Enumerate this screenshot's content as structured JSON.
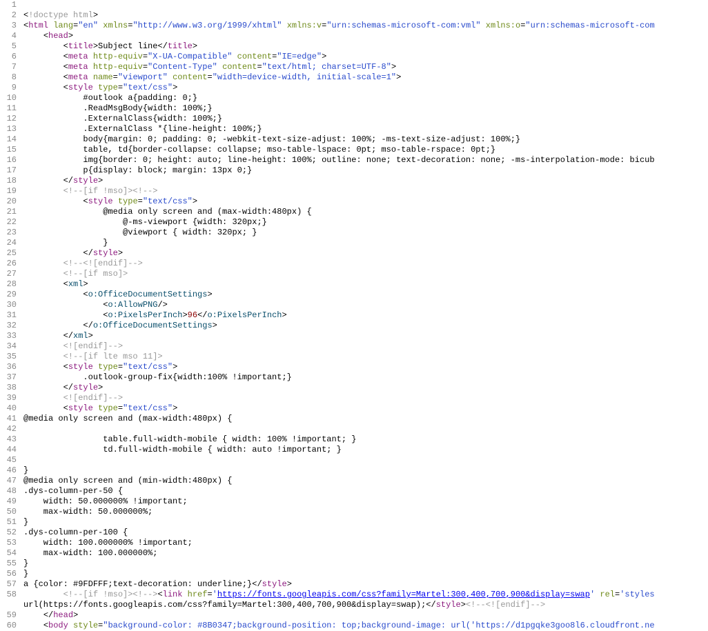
{
  "lines": [
    {
      "num": 1,
      "segs": []
    },
    {
      "num": 2,
      "segs": [
        {
          "c": "t-bracket",
          "t": "<"
        },
        {
          "c": "t-comment",
          "t": "!doctype html"
        },
        {
          "c": "t-bracket",
          "t": ">"
        }
      ]
    },
    {
      "num": 3,
      "segs": [
        {
          "c": "t-bracket",
          "t": "<"
        },
        {
          "c": "t-tag",
          "t": "html"
        },
        {
          "c": "t-text",
          "t": " "
        },
        {
          "c": "t-attr",
          "t": "lang"
        },
        {
          "c": "t-text",
          "t": "="
        },
        {
          "c": "t-val",
          "t": "\"en\""
        },
        {
          "c": "t-text",
          "t": " "
        },
        {
          "c": "t-attr",
          "t": "xmlns"
        },
        {
          "c": "t-text",
          "t": "="
        },
        {
          "c": "t-val",
          "t": "\"http://www.w3.org/1999/xhtml\""
        },
        {
          "c": "t-text",
          "t": " "
        },
        {
          "c": "t-attr",
          "t": "xmlns:v"
        },
        {
          "c": "t-text",
          "t": "="
        },
        {
          "c": "t-val",
          "t": "\"urn:schemas-microsoft-com:vml\""
        },
        {
          "c": "t-text",
          "t": " "
        },
        {
          "c": "t-attr",
          "t": "xmlns:o"
        },
        {
          "c": "t-text",
          "t": "="
        },
        {
          "c": "t-val",
          "t": "\"urn:schemas-microsoft-com"
        }
      ]
    },
    {
      "num": 4,
      "segs": [
        {
          "c": "t-text",
          "t": "    "
        },
        {
          "c": "t-bracket",
          "t": "<"
        },
        {
          "c": "t-tag",
          "t": "head"
        },
        {
          "c": "t-bracket",
          "t": ">"
        }
      ]
    },
    {
      "num": 5,
      "segs": [
        {
          "c": "t-text",
          "t": "        "
        },
        {
          "c": "t-bracket",
          "t": "<"
        },
        {
          "c": "t-tag",
          "t": "title"
        },
        {
          "c": "t-bracket",
          "t": ">"
        },
        {
          "c": "t-text",
          "t": "Subject line"
        },
        {
          "c": "t-bracket",
          "t": "</"
        },
        {
          "c": "t-tag",
          "t": "title"
        },
        {
          "c": "t-bracket",
          "t": ">"
        }
      ]
    },
    {
      "num": 6,
      "segs": [
        {
          "c": "t-text",
          "t": "        "
        },
        {
          "c": "t-bracket",
          "t": "<"
        },
        {
          "c": "t-tag",
          "t": "meta"
        },
        {
          "c": "t-text",
          "t": " "
        },
        {
          "c": "t-attr",
          "t": "http-equiv"
        },
        {
          "c": "t-text",
          "t": "="
        },
        {
          "c": "t-val",
          "t": "\"X-UA-Compatible\""
        },
        {
          "c": "t-text",
          "t": " "
        },
        {
          "c": "t-attr",
          "t": "content"
        },
        {
          "c": "t-text",
          "t": "="
        },
        {
          "c": "t-val",
          "t": "\"IE=edge\""
        },
        {
          "c": "t-bracket",
          "t": ">"
        }
      ]
    },
    {
      "num": 7,
      "segs": [
        {
          "c": "t-text",
          "t": "        "
        },
        {
          "c": "t-bracket",
          "t": "<"
        },
        {
          "c": "t-tag",
          "t": "meta"
        },
        {
          "c": "t-text",
          "t": " "
        },
        {
          "c": "t-attr",
          "t": "http-equiv"
        },
        {
          "c": "t-text",
          "t": "="
        },
        {
          "c": "t-val",
          "t": "\"Content-Type\""
        },
        {
          "c": "t-text",
          "t": " "
        },
        {
          "c": "t-attr",
          "t": "content"
        },
        {
          "c": "t-text",
          "t": "="
        },
        {
          "c": "t-val",
          "t": "\"text/html; charset=UTF-8\""
        },
        {
          "c": "t-bracket",
          "t": ">"
        }
      ]
    },
    {
      "num": 8,
      "segs": [
        {
          "c": "t-text",
          "t": "        "
        },
        {
          "c": "t-bracket",
          "t": "<"
        },
        {
          "c": "t-tag",
          "t": "meta"
        },
        {
          "c": "t-text",
          "t": " "
        },
        {
          "c": "t-attr",
          "t": "name"
        },
        {
          "c": "t-text",
          "t": "="
        },
        {
          "c": "t-val",
          "t": "\"viewport\""
        },
        {
          "c": "t-text",
          "t": " "
        },
        {
          "c": "t-attr",
          "t": "content"
        },
        {
          "c": "t-text",
          "t": "="
        },
        {
          "c": "t-val",
          "t": "\"width=device-width, initial-scale=1\""
        },
        {
          "c": "t-bracket",
          "t": ">"
        }
      ]
    },
    {
      "num": 9,
      "segs": [
        {
          "c": "t-text",
          "t": "        "
        },
        {
          "c": "t-bracket",
          "t": "<"
        },
        {
          "c": "t-tag",
          "t": "style"
        },
        {
          "c": "t-text",
          "t": " "
        },
        {
          "c": "t-attr",
          "t": "type"
        },
        {
          "c": "t-text",
          "t": "="
        },
        {
          "c": "t-val",
          "t": "\"text/css\""
        },
        {
          "c": "t-bracket",
          "t": ">"
        }
      ]
    },
    {
      "num": 10,
      "segs": [
        {
          "c": "t-text",
          "t": "            #outlook a{padding: 0;}"
        }
      ]
    },
    {
      "num": 11,
      "segs": [
        {
          "c": "t-text",
          "t": "            .ReadMsgBody{width: 100%;}"
        }
      ]
    },
    {
      "num": 12,
      "segs": [
        {
          "c": "t-text",
          "t": "            .ExternalClass{width: 100%;}"
        }
      ]
    },
    {
      "num": 13,
      "segs": [
        {
          "c": "t-text",
          "t": "            .ExternalClass *{line-height: 100%;}"
        }
      ]
    },
    {
      "num": 14,
      "segs": [
        {
          "c": "t-text",
          "t": "            body{margin: 0; padding: 0; -webkit-text-size-adjust: 100%; -ms-text-size-adjust: 100%;}"
        }
      ]
    },
    {
      "num": 15,
      "segs": [
        {
          "c": "t-text",
          "t": "            table, td{border-collapse: collapse; mso-table-lspace: 0pt; mso-table-rspace: 0pt;}"
        }
      ]
    },
    {
      "num": 16,
      "segs": [
        {
          "c": "t-text",
          "t": "            img{border: 0; height: auto; line-height: 100%; outline: none; text-decoration: none; -ms-interpolation-mode: bicub"
        }
      ]
    },
    {
      "num": 17,
      "segs": [
        {
          "c": "t-text",
          "t": "            p{display: block; margin: 13px 0;}"
        }
      ]
    },
    {
      "num": 18,
      "segs": [
        {
          "c": "t-text",
          "t": "        "
        },
        {
          "c": "t-bracket",
          "t": "</"
        },
        {
          "c": "t-tag",
          "t": "style"
        },
        {
          "c": "t-bracket",
          "t": ">"
        }
      ]
    },
    {
      "num": 19,
      "segs": [
        {
          "c": "t-text",
          "t": "        "
        },
        {
          "c": "t-comment",
          "t": "<!--[if !mso]><!-->"
        }
      ]
    },
    {
      "num": 20,
      "segs": [
        {
          "c": "t-text",
          "t": "            "
        },
        {
          "c": "t-bracket",
          "t": "<"
        },
        {
          "c": "t-tag",
          "t": "style"
        },
        {
          "c": "t-text",
          "t": " "
        },
        {
          "c": "t-attr",
          "t": "type"
        },
        {
          "c": "t-text",
          "t": "="
        },
        {
          "c": "t-val",
          "t": "\"text/css\""
        },
        {
          "c": "t-bracket",
          "t": ">"
        }
      ]
    },
    {
      "num": 21,
      "segs": [
        {
          "c": "t-text",
          "t": "                @media only screen and (max-width:480px) {"
        }
      ]
    },
    {
      "num": 22,
      "segs": [
        {
          "c": "t-text",
          "t": "                    @-ms-viewport {width: 320px;}"
        }
      ]
    },
    {
      "num": 23,
      "segs": [
        {
          "c": "t-text",
          "t": "                    @viewport { width: 320px; }"
        }
      ]
    },
    {
      "num": 24,
      "segs": [
        {
          "c": "t-text",
          "t": "                }"
        }
      ]
    },
    {
      "num": 25,
      "segs": [
        {
          "c": "t-text",
          "t": "            "
        },
        {
          "c": "t-bracket",
          "t": "</"
        },
        {
          "c": "t-tag",
          "t": "style"
        },
        {
          "c": "t-bracket",
          "t": ">"
        }
      ]
    },
    {
      "num": 26,
      "segs": [
        {
          "c": "t-text",
          "t": "        "
        },
        {
          "c": "t-comment",
          "t": "<!--<![endif]-->"
        }
      ]
    },
    {
      "num": 27,
      "segs": [
        {
          "c": "t-text",
          "t": "        "
        },
        {
          "c": "t-comment",
          "t": "<!--[if mso]>"
        }
      ]
    },
    {
      "num": 28,
      "segs": [
        {
          "c": "t-text",
          "t": "        "
        },
        {
          "c": "t-bracket",
          "t": "<"
        },
        {
          "c": "t-tag-alt",
          "t": "xml"
        },
        {
          "c": "t-bracket",
          "t": ">"
        }
      ]
    },
    {
      "num": 29,
      "segs": [
        {
          "c": "t-text",
          "t": "            "
        },
        {
          "c": "t-bracket",
          "t": "<"
        },
        {
          "c": "t-tag-alt",
          "t": "o:OfficeDocumentSettings"
        },
        {
          "c": "t-bracket",
          "t": ">"
        }
      ]
    },
    {
      "num": 30,
      "segs": [
        {
          "c": "t-text",
          "t": "                "
        },
        {
          "c": "t-bracket",
          "t": "<"
        },
        {
          "c": "t-tag-alt",
          "t": "o:AllowPNG"
        },
        {
          "c": "t-bracket",
          "t": "/>"
        }
      ]
    },
    {
      "num": 31,
      "segs": [
        {
          "c": "t-text",
          "t": "                "
        },
        {
          "c": "t-bracket",
          "t": "<"
        },
        {
          "c": "t-tag-alt",
          "t": "o:PixelsPerInch"
        },
        {
          "c": "t-bracket",
          "t": ">"
        },
        {
          "c": "t-num",
          "t": "96"
        },
        {
          "c": "t-bracket",
          "t": "</"
        },
        {
          "c": "t-tag-alt",
          "t": "o:PixelsPerInch"
        },
        {
          "c": "t-bracket",
          "t": ">"
        }
      ]
    },
    {
      "num": 32,
      "segs": [
        {
          "c": "t-text",
          "t": "            "
        },
        {
          "c": "t-bracket",
          "t": "</"
        },
        {
          "c": "t-tag-alt",
          "t": "o:OfficeDocumentSettings"
        },
        {
          "c": "t-bracket",
          "t": ">"
        }
      ]
    },
    {
      "num": 33,
      "segs": [
        {
          "c": "t-text",
          "t": "        "
        },
        {
          "c": "t-bracket",
          "t": "</"
        },
        {
          "c": "t-tag-alt",
          "t": "xml"
        },
        {
          "c": "t-bracket",
          "t": ">"
        }
      ]
    },
    {
      "num": 34,
      "segs": [
        {
          "c": "t-text",
          "t": "        "
        },
        {
          "c": "t-comment",
          "t": "<![endif]-->"
        }
      ]
    },
    {
      "num": 35,
      "segs": [
        {
          "c": "t-text",
          "t": "        "
        },
        {
          "c": "t-comment",
          "t": "<!--[if lte mso 11]>"
        }
      ]
    },
    {
      "num": 36,
      "segs": [
        {
          "c": "t-text",
          "t": "        "
        },
        {
          "c": "t-bracket",
          "t": "<"
        },
        {
          "c": "t-tag",
          "t": "style"
        },
        {
          "c": "t-text",
          "t": " "
        },
        {
          "c": "t-attr",
          "t": "type"
        },
        {
          "c": "t-text",
          "t": "="
        },
        {
          "c": "t-val",
          "t": "\"text/css\""
        },
        {
          "c": "t-bracket",
          "t": ">"
        }
      ]
    },
    {
      "num": 37,
      "segs": [
        {
          "c": "t-text",
          "t": "            .outlook-group-fix{width:100% !important;}"
        }
      ]
    },
    {
      "num": 38,
      "segs": [
        {
          "c": "t-text",
          "t": "        "
        },
        {
          "c": "t-bracket",
          "t": "</"
        },
        {
          "c": "t-tag",
          "t": "style"
        },
        {
          "c": "t-bracket",
          "t": ">"
        }
      ]
    },
    {
      "num": 39,
      "segs": [
        {
          "c": "t-text",
          "t": "        "
        },
        {
          "c": "t-comment",
          "t": "<![endif]-->"
        }
      ]
    },
    {
      "num": 40,
      "segs": [
        {
          "c": "t-text",
          "t": "        "
        },
        {
          "c": "t-bracket",
          "t": "<"
        },
        {
          "c": "t-tag",
          "t": "style"
        },
        {
          "c": "t-text",
          "t": " "
        },
        {
          "c": "t-attr",
          "t": "type"
        },
        {
          "c": "t-text",
          "t": "="
        },
        {
          "c": "t-val",
          "t": "\"text/css\""
        },
        {
          "c": "t-bracket",
          "t": ">"
        }
      ]
    },
    {
      "num": 41,
      "segs": [
        {
          "c": "t-text",
          "t": "@media only screen and (max-width:480px) {"
        }
      ]
    },
    {
      "num": 42,
      "segs": [
        {
          "c": "t-text",
          "t": ""
        }
      ]
    },
    {
      "num": 43,
      "segs": [
        {
          "c": "t-text",
          "t": "                table.full-width-mobile { width: 100% !important; }"
        }
      ]
    },
    {
      "num": 44,
      "segs": [
        {
          "c": "t-text",
          "t": "                td.full-width-mobile { width: auto !important; }"
        }
      ]
    },
    {
      "num": 45,
      "segs": [
        {
          "c": "t-text",
          "t": ""
        }
      ]
    },
    {
      "num": 46,
      "segs": [
        {
          "c": "t-text",
          "t": "}"
        }
      ]
    },
    {
      "num": 47,
      "segs": [
        {
          "c": "t-text",
          "t": "@media only screen and (min-width:480px) {"
        }
      ]
    },
    {
      "num": 48,
      "segs": [
        {
          "c": "t-text",
          "t": ".dys-column-per-50 {"
        }
      ]
    },
    {
      "num": 49,
      "segs": [
        {
          "c": "t-text",
          "t": "    width: 50.000000% !important;"
        }
      ]
    },
    {
      "num": 50,
      "segs": [
        {
          "c": "t-text",
          "t": "    max-width: 50.000000%;"
        }
      ]
    },
    {
      "num": 51,
      "segs": [
        {
          "c": "t-text",
          "t": "}"
        }
      ]
    },
    {
      "num": 52,
      "segs": [
        {
          "c": "t-text",
          "t": ".dys-column-per-100 {"
        }
      ]
    },
    {
      "num": 53,
      "segs": [
        {
          "c": "t-text",
          "t": "    width: 100.000000% !important;"
        }
      ]
    },
    {
      "num": 54,
      "segs": [
        {
          "c": "t-text",
          "t": "    max-width: 100.000000%;"
        }
      ]
    },
    {
      "num": 55,
      "segs": [
        {
          "c": "t-text",
          "t": "}"
        }
      ]
    },
    {
      "num": 56,
      "segs": [
        {
          "c": "t-text",
          "t": "}"
        }
      ]
    },
    {
      "num": 57,
      "segs": [
        {
          "c": "t-text",
          "t": "a {color: #9FDFFF;text-decoration: underline;}"
        },
        {
          "c": "t-bracket",
          "t": "</"
        },
        {
          "c": "t-tag",
          "t": "style"
        },
        {
          "c": "t-bracket",
          "t": ">"
        }
      ]
    },
    {
      "num": 58,
      "segs": [
        {
          "c": "t-text",
          "t": "        "
        },
        {
          "c": "t-comment",
          "t": "<!--[if !mso]><!-->"
        },
        {
          "c": "t-bracket",
          "t": "<"
        },
        {
          "c": "t-tag",
          "t": "link"
        },
        {
          "c": "t-text",
          "t": " "
        },
        {
          "c": "t-attr",
          "t": "href"
        },
        {
          "c": "t-text",
          "t": "="
        },
        {
          "c": "t-val",
          "t": "'"
        },
        {
          "c": "t-url",
          "t": "https://fonts.googleapis.com/css?family=Martel:300,400,700,900&display=swap"
        },
        {
          "c": "t-val",
          "t": "'"
        },
        {
          "c": "t-text",
          "t": " "
        },
        {
          "c": "t-attr",
          "t": "rel"
        },
        {
          "c": "t-text",
          "t": "="
        },
        {
          "c": "t-val",
          "t": "'styles"
        }
      ]
    },
    {
      "num": "",
      "segs": [
        {
          "c": "t-text",
          "t": "url(https://fonts.googleapis.com/css?family=Martel:300,400,700,900&display=swap);"
        },
        {
          "c": "t-bracket",
          "t": "</"
        },
        {
          "c": "t-tag",
          "t": "style"
        },
        {
          "c": "t-bracket",
          "t": ">"
        },
        {
          "c": "t-comment",
          "t": "<!--<![endif]-->"
        }
      ]
    },
    {
      "num": 59,
      "segs": [
        {
          "c": "t-text",
          "t": "    "
        },
        {
          "c": "t-bracket",
          "t": "</"
        },
        {
          "c": "t-tag",
          "t": "head"
        },
        {
          "c": "t-bracket",
          "t": ">"
        }
      ]
    },
    {
      "num": 60,
      "segs": [
        {
          "c": "t-text",
          "t": "    "
        },
        {
          "c": "t-bracket",
          "t": "<"
        },
        {
          "c": "t-tag",
          "t": "body"
        },
        {
          "c": "t-text",
          "t": " "
        },
        {
          "c": "t-attr",
          "t": "style"
        },
        {
          "c": "t-text",
          "t": "="
        },
        {
          "c": "t-val",
          "t": "\"background-color: #8B0347;background-position: top;background-image: url('https://d1pgqke3goo8l6.cloudfront.ne"
        }
      ]
    }
  ]
}
